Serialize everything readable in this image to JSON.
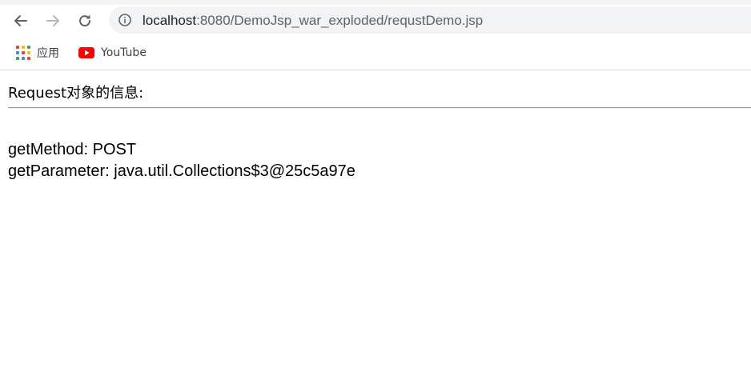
{
  "browser": {
    "url_host": "localhost",
    "url_rest": ":8080/DemoJsp_war_exploded/requstDemo.jsp",
    "icons": {
      "back": "arrow-left-icon",
      "forward": "arrow-right-icon",
      "reload": "reload-icon",
      "site_info": "info-icon"
    }
  },
  "bookmarks": [
    {
      "label": "应用",
      "icon": "apps-grid-icon"
    },
    {
      "label": "YouTube",
      "icon": "youtube-icon"
    }
  ],
  "page": {
    "heading": "Request对象的信息:",
    "lines": [
      "getMethod: POST",
      "getParameter: java.util.Collections$3@25c5a97e"
    ]
  },
  "colors": {
    "omnibox_bg": "#f1f3f4",
    "youtube_red": "#ff0000",
    "apps_colors": [
      "#ea4335",
      "#fbbc04",
      "#34a853",
      "#4285f4"
    ]
  }
}
